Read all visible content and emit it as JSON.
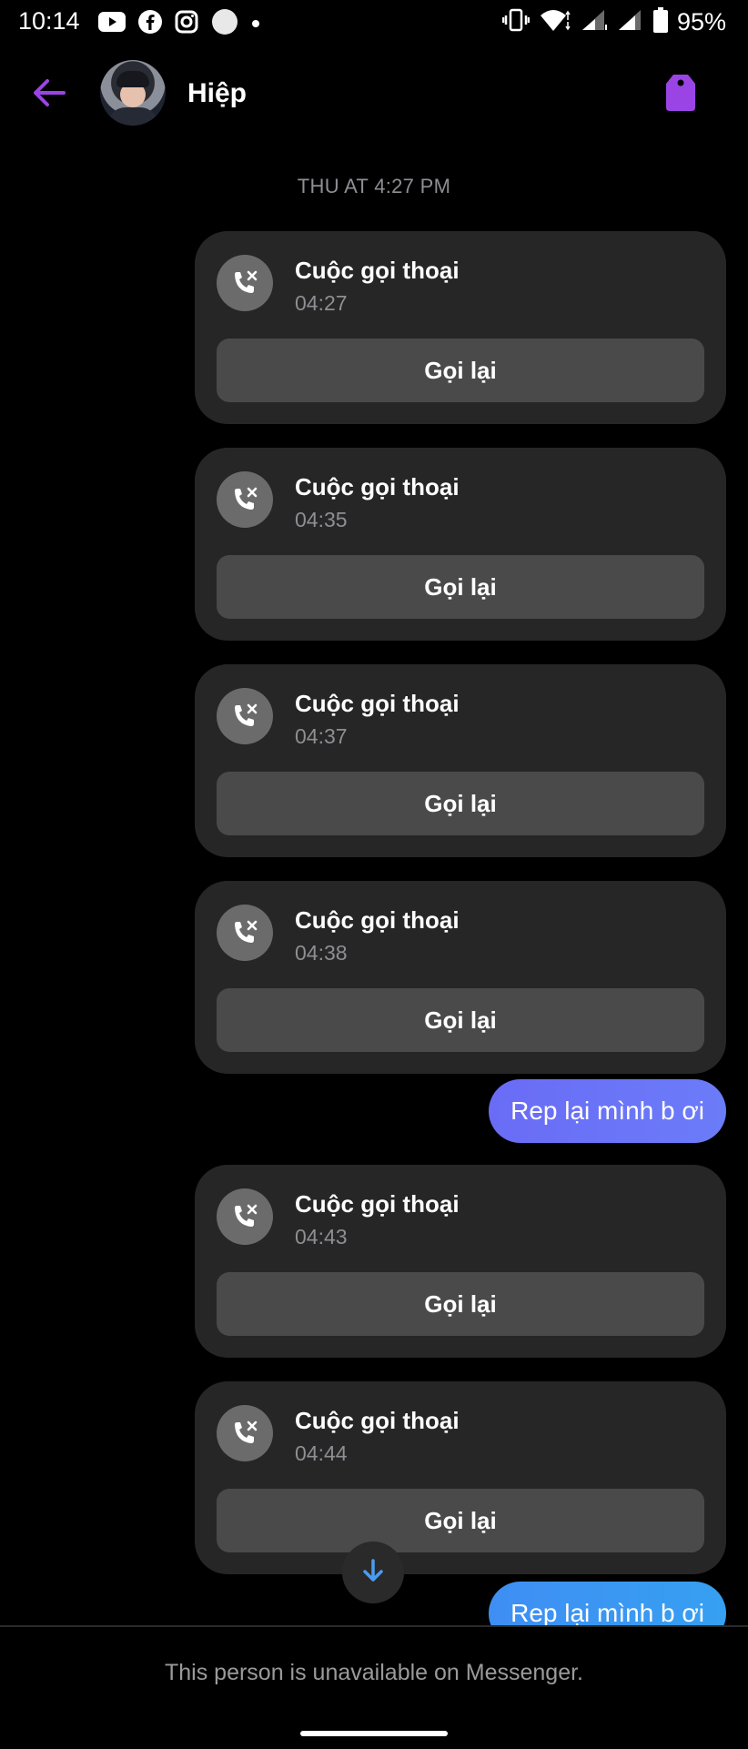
{
  "status_bar": {
    "time": "10:14",
    "battery": "95%",
    "left_icons": [
      "youtube-icon",
      "facebook-icon",
      "instagram-icon",
      "messenger-bubble-icon",
      "dot-icon"
    ],
    "right_icons": [
      "vibrate-icon",
      "wifi-icon",
      "signal-icon",
      "signal-icon",
      "battery-icon"
    ]
  },
  "header": {
    "contact_name": "Hiệp",
    "accent_color": "#9b44e6"
  },
  "chat": {
    "timestamp": "THU AT 4:27 PM",
    "calls": [
      {
        "title": "Cuộc gọi thoại",
        "time": "04:27",
        "button": "Gọi lại"
      },
      {
        "title": "Cuộc gọi thoại",
        "time": "04:35",
        "button": "Gọi lại"
      },
      {
        "title": "Cuộc gọi thoại",
        "time": "04:37",
        "button": "Gọi lại"
      },
      {
        "title": "Cuộc gọi thoại",
        "time": "04:38",
        "button": "Gọi lại"
      },
      {
        "title": "Cuộc gọi thoại",
        "time": "04:43",
        "button": "Gọi lại"
      },
      {
        "title": "Cuộc gọi thoại",
        "time": "04:44",
        "button": "Gọi lại"
      }
    ],
    "messages": [
      {
        "text": "Rep lại mình b ơi"
      },
      {
        "text": "Rep lại mình b ơi"
      }
    ]
  },
  "footer": {
    "text": "This person is unavailable on Messenger."
  }
}
